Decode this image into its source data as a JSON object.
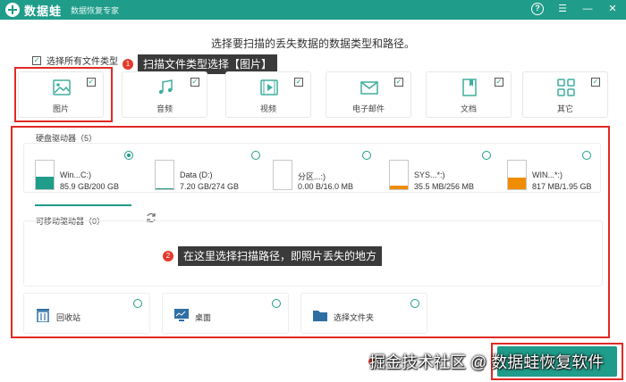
{
  "app": {
    "name": "数据蛙",
    "subtitle": "数据恢复专家"
  },
  "window_controls": {
    "help": "?",
    "menu": "☰",
    "minimize": "—",
    "close": "✕"
  },
  "heading": "选择要扫描的丢失数据的数据类型和路径。",
  "select_all": {
    "label": "选择所有文件类型",
    "checked": true
  },
  "callout1": {
    "num": "1",
    "text": "扫描文件类型选择【图片】"
  },
  "file_types": [
    {
      "label": "图片",
      "icon": "image-icon",
      "checked": true
    },
    {
      "label": "音频",
      "icon": "music-icon",
      "checked": true
    },
    {
      "label": "视频",
      "icon": "video-icon",
      "checked": true
    },
    {
      "label": "电子邮件",
      "icon": "email-icon",
      "checked": true
    },
    {
      "label": "文档",
      "icon": "document-icon",
      "checked": true
    },
    {
      "label": "其它",
      "icon": "other-icon",
      "checked": true
    }
  ],
  "hard_drives": {
    "title": "硬盘驱动器（5）",
    "items": [
      {
        "name": "Win...C:)",
        "size": "85.9 GB/200 GB",
        "used": 0.43,
        "color": "#1f9c8a",
        "selected": true
      },
      {
        "name": "Data (D:)",
        "size": "7.20 GB/274 GB",
        "used": 0.03,
        "color": "#1f9c8a",
        "selected": false
      },
      {
        "name": "分区...:)",
        "size": "0.00  B/16.0 MB",
        "used": 0.0,
        "color": "#f08c00",
        "selected": false
      },
      {
        "name": "SYS...*:)",
        "size": "35.5 MB/256 MB",
        "used": 0.14,
        "color": "#f08c00",
        "selected": false
      },
      {
        "name": "WIN...*:)",
        "size": "817 MB/1.95 GB",
        "used": 0.42,
        "color": "#f08c00",
        "selected": false
      }
    ]
  },
  "removable": {
    "title": "可移动驱动器（0）",
    "refresh_icon": "refresh-icon"
  },
  "callout2": {
    "num": "2",
    "text": "在这里选择扫描路径，即照片丢失的地方"
  },
  "locations": [
    {
      "label": "回收站",
      "icon": "trash-icon"
    },
    {
      "label": "桌面",
      "icon": "desktop-icon"
    },
    {
      "label": "选择文件夹",
      "icon": "folder-icon"
    }
  ],
  "watermark": "掘金技术社区 @ 数据蛙恢复软件",
  "colors": {
    "accent": "#1f9c8a",
    "highlight": "#e02a24",
    "orange": "#f08c00"
  }
}
